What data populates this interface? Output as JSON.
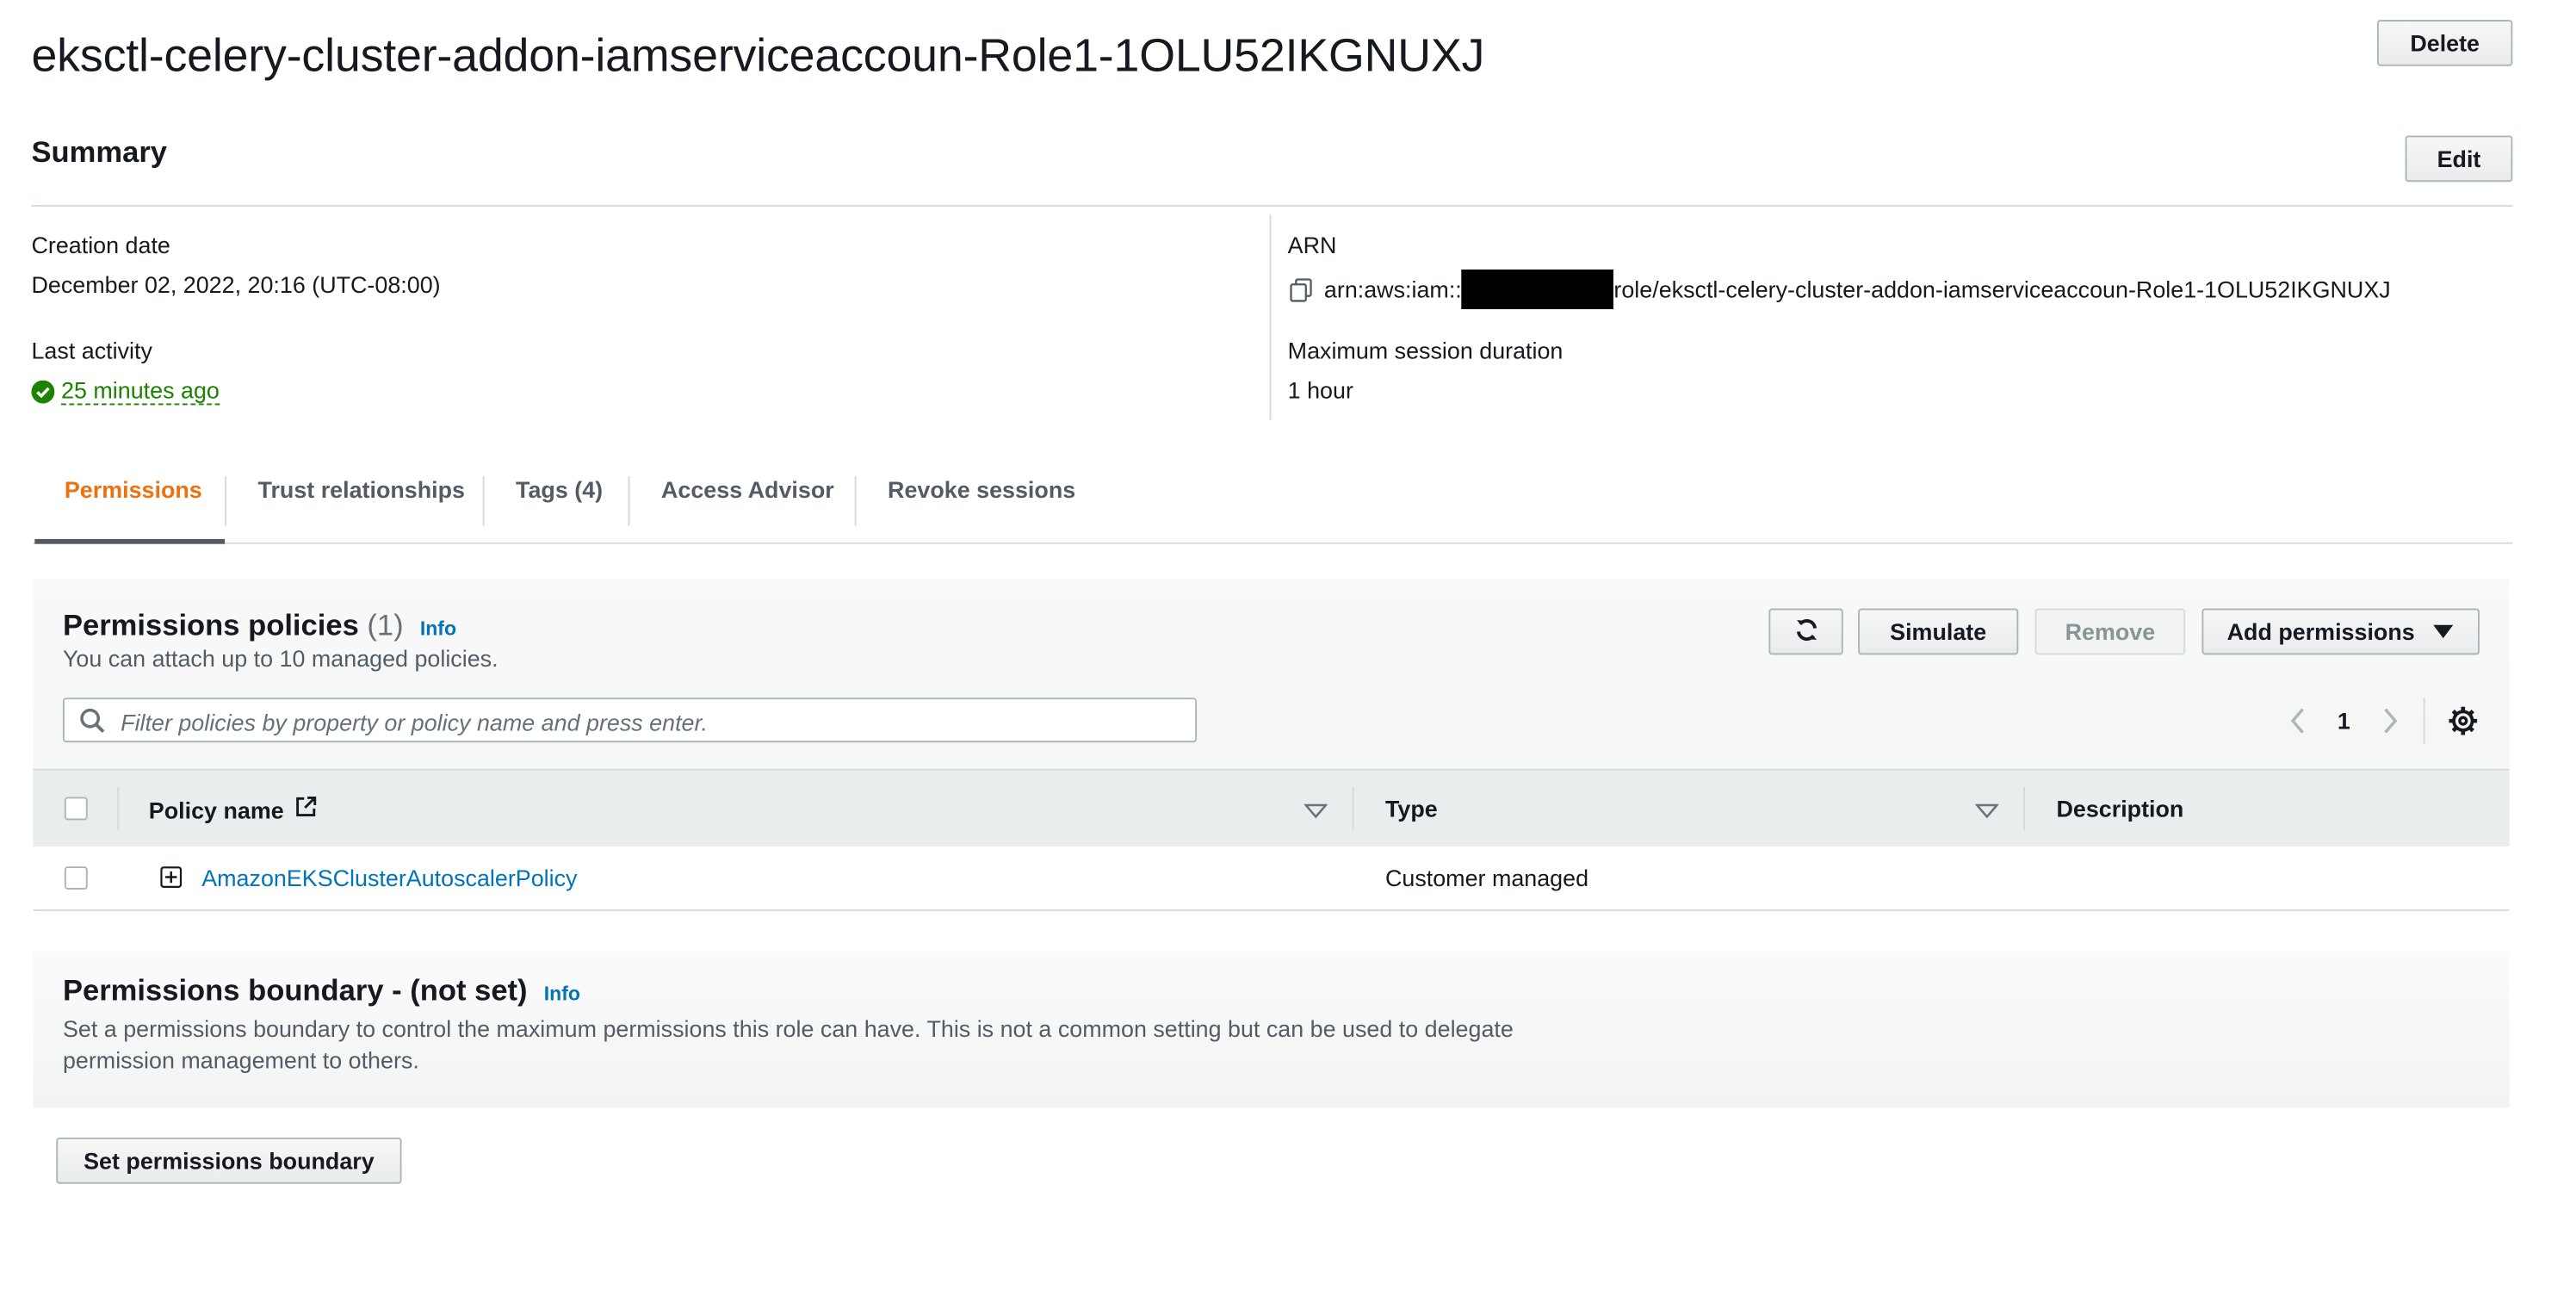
{
  "header": {
    "title": "eksctl-celery-cluster-addon-iamserviceaccoun-Role1-1OLU52IKGNUXJ",
    "delete_label": "Delete"
  },
  "summary": {
    "title": "Summary",
    "edit_label": "Edit",
    "creation_date_label": "Creation date",
    "creation_date_value": "December 02, 2022, 20:16 (UTC-08:00)",
    "last_activity_label": "Last activity",
    "last_activity_value": "25 minutes ago",
    "arn_label": "ARN",
    "arn_prefix": "arn:aws:iam::",
    "arn_suffix": "role/eksctl-celery-cluster-addon-iamserviceaccoun-Role1-1OLU52IKGNUXJ",
    "max_session_label": "Maximum session duration",
    "max_session_value": "1 hour"
  },
  "tabs": [
    {
      "label": "Permissions",
      "active": true
    },
    {
      "label": "Trust relationships",
      "active": false
    },
    {
      "label": "Tags (4)",
      "active": false
    },
    {
      "label": "Access Advisor",
      "active": false
    },
    {
      "label": "Revoke sessions",
      "active": false
    }
  ],
  "policies": {
    "title": "Permissions policies",
    "count": "(1)",
    "info_label": "Info",
    "subtitle": "You can attach up to 10 managed policies.",
    "simulate_label": "Simulate",
    "remove_label": "Remove",
    "add_permissions_label": "Add permissions",
    "search_placeholder": "Filter policies by property or policy name and press enter.",
    "page_number": "1",
    "columns": [
      "Policy name",
      "Type",
      "Description"
    ],
    "rows": [
      {
        "name": "AmazonEKSClusterAutoscalerPolicy",
        "type": "Customer managed",
        "description": ""
      }
    ]
  },
  "boundary": {
    "title": "Permissions boundary - (not set)",
    "info_label": "Info",
    "description_line1": "Set a permissions boundary to control the maximum permissions this role can have. This is not a common setting but can be used to delegate",
    "description_line2": "permission management to others.",
    "set_button_label": "Set permissions boundary"
  },
  "colors": {
    "accent": "#ec7211",
    "link": "#0073bb",
    "success": "#1d8102"
  }
}
